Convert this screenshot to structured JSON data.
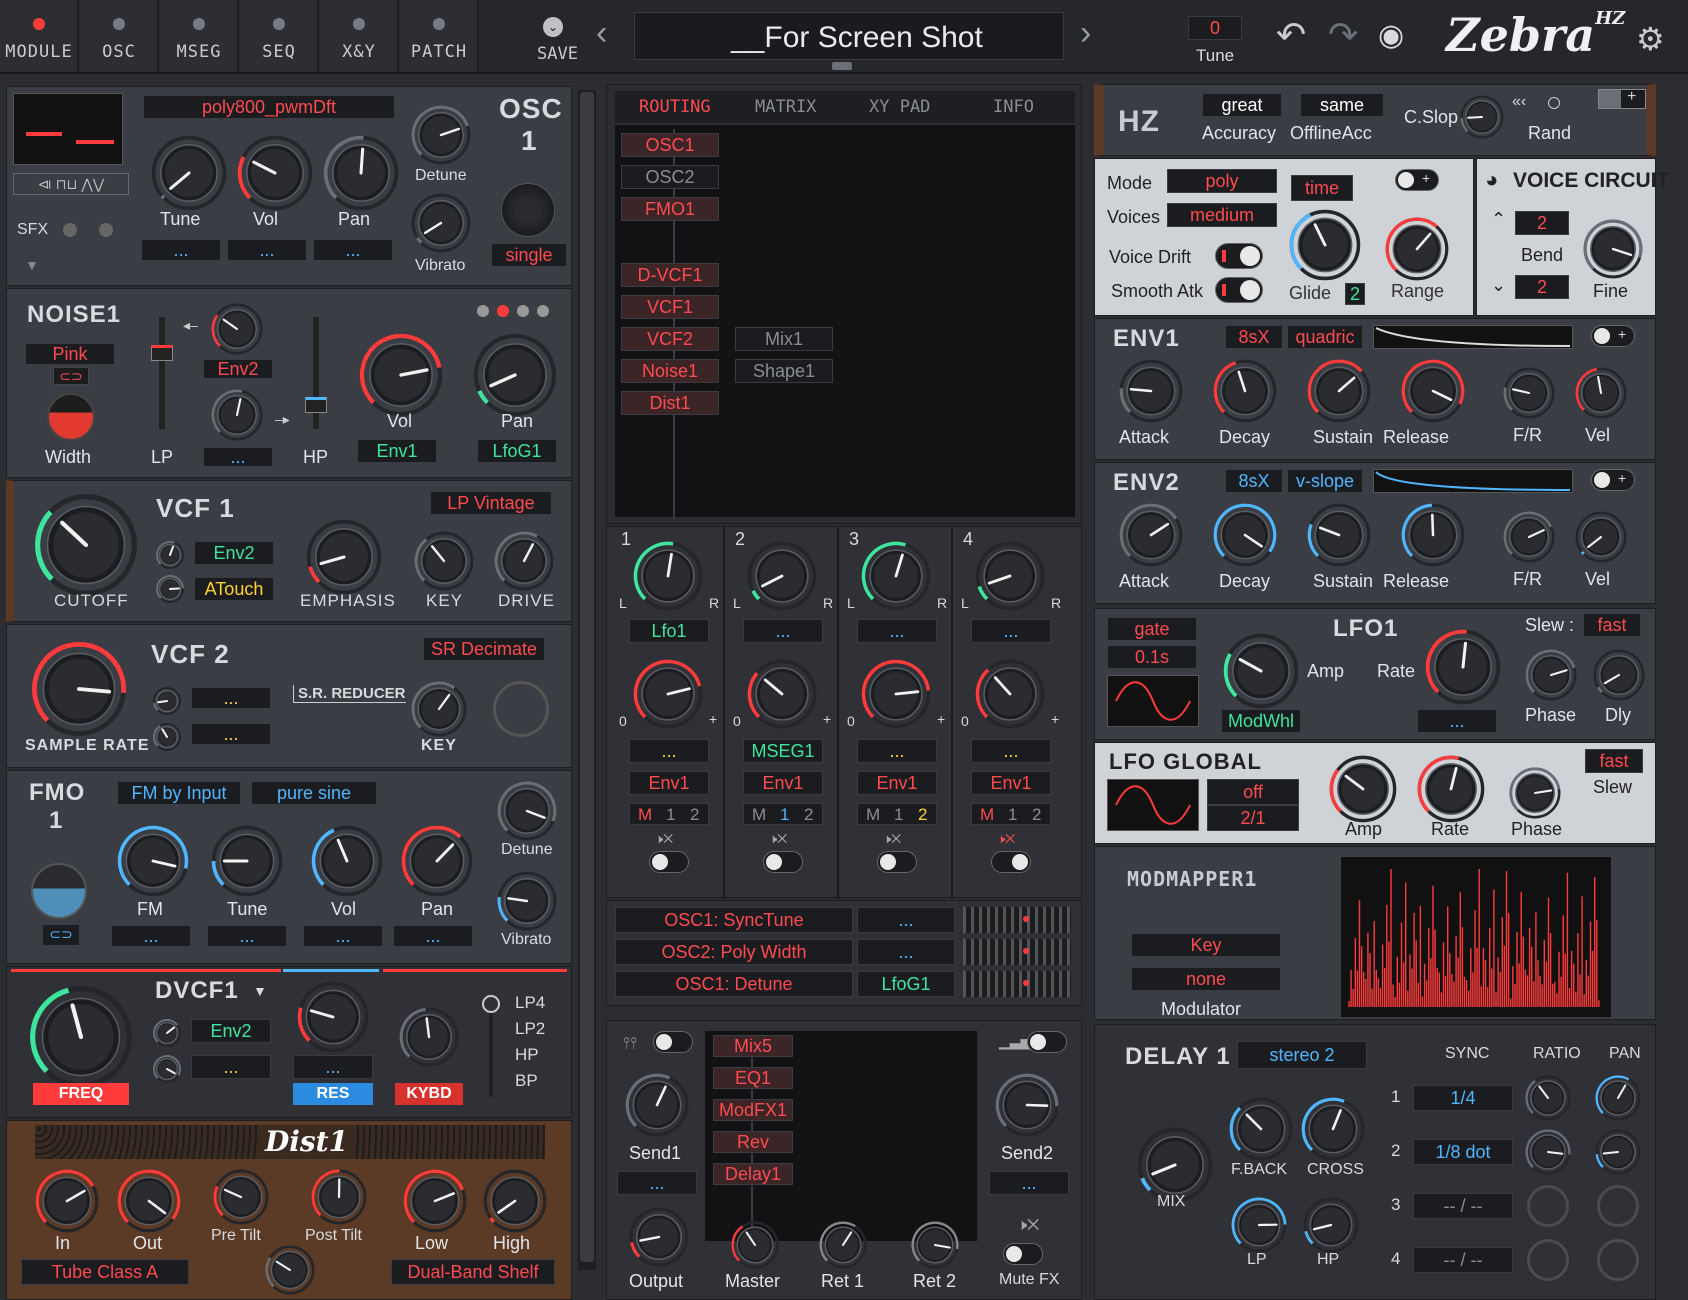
{
  "topbar": {
    "tabs": [
      {
        "label": "MODULE",
        "active": true
      },
      {
        "label": "OSC"
      },
      {
        "label": "MSEG"
      },
      {
        "label": "SEQ"
      },
      {
        "label": "X&Y"
      },
      {
        "label": "PATCH"
      }
    ],
    "save_label": "SAVE",
    "preset_name": "__For Screen Shot",
    "tune_value": "0",
    "tune_label": "Tune",
    "logo": "Zebra HZ",
    "icons": [
      "undo-icon",
      "redo-icon",
      "eye-icon",
      "gear-icon",
      "chevron-left-icon",
      "chevron-right-icon"
    ]
  },
  "osc1": {
    "title": "OSC",
    "number": "1",
    "wave_name": "poly800_pwmDft",
    "sfx": "SFX",
    "knobs": [
      "Tune",
      "Vol",
      "Pan"
    ],
    "mods": [
      "...",
      "...",
      "..."
    ],
    "detune": "Detune",
    "vibrato": "Vibrato",
    "mode": "single"
  },
  "noise1": {
    "title": "NOISE1",
    "type": "Pink",
    "width": "Width",
    "lp": "LP",
    "hp": "HP",
    "env_mod": "Env2",
    "mod2": "...",
    "vol": "Vol",
    "pan": "Pan",
    "vol_mod": "Env1",
    "pan_mod": "LfoG1"
  },
  "vcf1": {
    "title": "VCF 1",
    "type": "LP Vintage",
    "cutoff": "CUTOFF",
    "mod1": "Env2",
    "mod2": "ATouch",
    "emphasis": "EMPHASIS",
    "key": "KEY",
    "drive": "DRIVE"
  },
  "vcf2": {
    "title": "VCF 2",
    "type": "SR Decimate",
    "sample_rate": "SAMPLE RATE",
    "reducer": "S.R. REDUCER",
    "mod1": "...",
    "mod2": "...",
    "key": "KEY"
  },
  "fmo1": {
    "title": "FMO",
    "number": "1",
    "mode": "FM by Input",
    "wave": "pure sine",
    "knobs": [
      "FM",
      "Tune",
      "Vol",
      "Pan"
    ],
    "mods": [
      "...",
      "...",
      "...",
      "..."
    ],
    "detune": "Detune",
    "vibrato": "Vibrato"
  },
  "dvcf1": {
    "title": "DVCF1",
    "mod1": "Env2",
    "mod2": "...",
    "res_mod": "...",
    "freq": "FREQ",
    "res": "RES",
    "kybd": "KYBD",
    "modes": [
      "LP4",
      "LP2",
      "HP",
      "BP"
    ]
  },
  "dist1": {
    "title": "Dist1",
    "knobs": [
      "In",
      "Out",
      "Pre Tilt",
      "Post Tilt",
      "Low",
      "High"
    ],
    "type": "Tube Class A",
    "shelf": "Dual-Band Shelf"
  },
  "routing": {
    "tabs": [
      "ROUTING",
      "MATRIX",
      "XY PAD",
      "INFO"
    ],
    "modules": [
      "OSC1",
      "OSC2",
      "FMO1",
      "",
      "D-VCF1",
      "VCF1",
      "VCF2",
      "Noise1",
      "Dist1"
    ],
    "modules2": [
      "Mix1",
      "Shape1"
    ]
  },
  "channels": [
    {
      "num": "1",
      "mod1": "Lfo1",
      "mod2": "...",
      "mod3": "Env1",
      "lane": [
        "M",
        "1",
        "2"
      ]
    },
    {
      "num": "2",
      "mod1": "...",
      "mod2": "MSEG1",
      "mod3": "Env1",
      "lane": [
        "M",
        "1",
        "2"
      ]
    },
    {
      "num": "3",
      "mod1": "...",
      "mod2": "...",
      "mod3": "Env1",
      "lane": [
        "M",
        "1",
        "2"
      ]
    },
    {
      "num": "4",
      "mod1": "...",
      "mod2": "...",
      "mod3": "Env1",
      "lane": [
        "M",
        "1",
        "2"
      ]
    }
  ],
  "pan_labels": [
    "L",
    "R"
  ],
  "vol_labels": [
    "0",
    "+"
  ],
  "xy_assign": [
    {
      "target": "OSC1: SyncTune",
      "source": "..."
    },
    {
      "target": "OSC2: Poly Width",
      "source": "..."
    },
    {
      "target": "OSC1: Detune",
      "source": "LfoG1"
    }
  ],
  "fx_grid": {
    "items": [
      "Mix5",
      "EQ1",
      "ModFX1",
      "Rev",
      "Delay1"
    ],
    "send1": "Send1",
    "send2": "Send2",
    "send1_mod": "...",
    "send2_mod": "...",
    "knobs": [
      "Output",
      "Master",
      "Ret 1",
      "Ret 2"
    ],
    "mute_fx": "Mute FX"
  },
  "hz": {
    "title": "HZ",
    "accuracy_val": "great",
    "accuracy": "Accuracy",
    "offline_val": "same",
    "offline": "OfflineAcc",
    "cslop": "C.Slop",
    "rand": "Rand",
    "rand_sym": "«‹"
  },
  "voice": {
    "mode_label": "Mode",
    "mode": "poly",
    "voices_label": "Voices",
    "voices": "medium",
    "drift": "Voice Drift",
    "smooth": "Smooth Atk",
    "time": "time",
    "glide": "Glide",
    "glide_val": "2",
    "range": "Range",
    "circuit": "VOICE CIRCUIT",
    "bend_up": "2",
    "bend": "Bend",
    "bend_down": "2",
    "fine": "Fine"
  },
  "env1": {
    "title": "ENV1",
    "res": "8sX",
    "shape": "quadric",
    "knobs": [
      "Attack",
      "Decay",
      "Sustain",
      "Release",
      "F/R",
      "Vel"
    ]
  },
  "env2": {
    "title": "ENV2",
    "res": "8sX",
    "shape": "v-slope",
    "knobs": [
      "Attack",
      "Decay",
      "Sustain",
      "Release",
      "F/R",
      "Vel"
    ]
  },
  "lfo1": {
    "title": "LFO1",
    "sync": "gate",
    "rate_val": "0.1s",
    "amp_mod": "ModWhl",
    "amp": "Amp",
    "rate": "Rate",
    "rate_mod": "...",
    "slew_label": "Slew :",
    "slew": "fast",
    "phase": "Phase",
    "dly": "Dly"
  },
  "lfog": {
    "title": "LFO GLOBAL",
    "sync": "off",
    "rate_val": "2/1",
    "amp": "Amp",
    "rate": "Rate",
    "phase": "Phase",
    "slew_val": "fast",
    "slew": "Slew"
  },
  "modmapper": {
    "title": "MODMAPPER1",
    "source": "Key",
    "modulator_val": "none",
    "modulator": "Modulator"
  },
  "delay": {
    "title": "DELAY 1",
    "mode": "stereo 2",
    "headers": [
      "SYNC",
      "RATIO",
      "PAN"
    ],
    "rows": [
      {
        "n": "1",
        "sync": "1/4"
      },
      {
        "n": "2",
        "sync": "1/8 dot"
      },
      {
        "n": "3",
        "sync": "-- / --"
      },
      {
        "n": "4",
        "sync": "-- / --"
      }
    ],
    "knobs": [
      "MIX",
      "F.BACK",
      "CROSS",
      "LP",
      "HP"
    ]
  },
  "colors": {
    "accent_red": "#ff4a4f",
    "accent_green": "#3fe59d",
    "accent_blue": "#4fb6ff",
    "lcd_bg": "#1b1c1f"
  }
}
